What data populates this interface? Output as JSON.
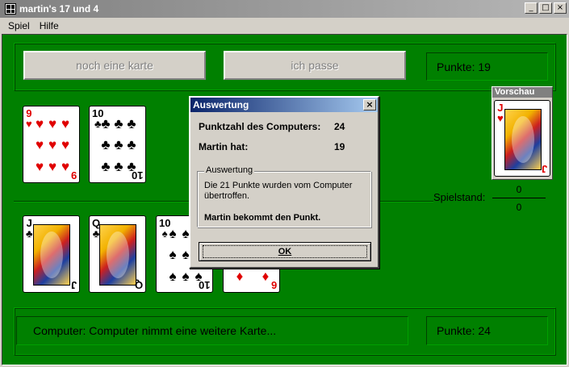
{
  "window": {
    "title": "martin's 17 und 4"
  },
  "titlebar_buttons": [
    "_",
    "□",
    "×"
  ],
  "menu": [
    "Spiel",
    "Hilfe"
  ],
  "toolbar": {
    "draw_label": "noch eine karte",
    "pass_label": "ich passe"
  },
  "player": {
    "points_label": "Punkte: 19"
  },
  "computer": {
    "status": "Computer:  Computer nimmt eine weitere Karte...",
    "points_label": "Punkte: 24"
  },
  "vorschau": {
    "title": "Vorschau",
    "card": {
      "rank": "J",
      "suit": "♥"
    }
  },
  "score": {
    "label": "Spielstand:",
    "player": "0",
    "computer": "0"
  },
  "player_cards": [
    {
      "rank": "9",
      "suit": "♥",
      "color": "#e00000"
    },
    {
      "rank": "10",
      "suit": "♣",
      "color": "#000000"
    }
  ],
  "computer_cards": [
    {
      "rank": "J",
      "suit": "♣",
      "color": "#000000"
    },
    {
      "rank": "Q",
      "suit": "♣",
      "color": "#000000"
    },
    {
      "rank": "10",
      "suit": "♠",
      "color": "#000000"
    },
    {
      "rank": "6",
      "suit": "♦",
      "color": "#e00000"
    }
  ],
  "dialog": {
    "title": "Auswertung",
    "close": "×",
    "computer_label": "Punktzahl des Computers:",
    "computer_value": "24",
    "player_label": "Martin hat:",
    "player_value": "19",
    "group_title": "Auswertung",
    "message": "Die 21 Punkte wurden vom Computer übertroffen.",
    "result": "Martin bekommt den Punkt.",
    "ok_label": "OK"
  },
  "colors": {
    "felt": "#008000",
    "dialog_title": "#0a246a",
    "red_suit": "#e00000"
  }
}
